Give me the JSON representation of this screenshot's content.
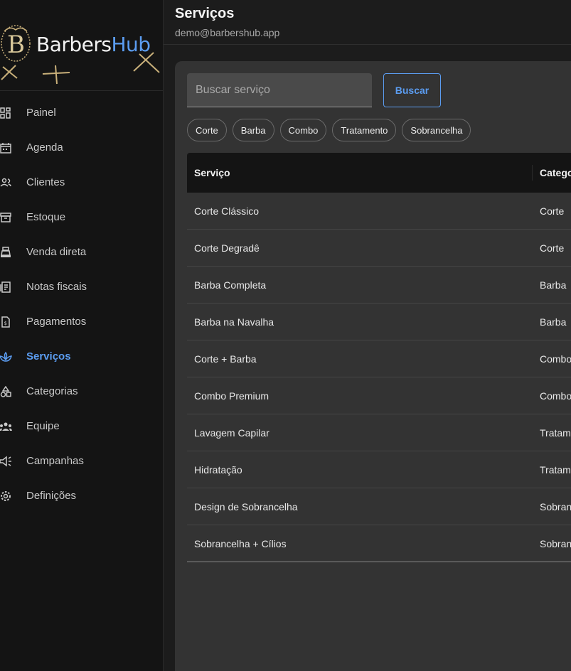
{
  "app": {
    "brand_part1": "Barbers",
    "brand_part2": "Hub",
    "brand_color": "#5b9cf0"
  },
  "sidebar": {
    "items": [
      {
        "label": "Painel",
        "icon": "dashboard-icon"
      },
      {
        "label": "Agenda",
        "icon": "calendar-icon"
      },
      {
        "label": "Clientes",
        "icon": "clients-icon"
      },
      {
        "label": "Estoque",
        "icon": "inventory-icon"
      },
      {
        "label": "Venda direta",
        "icon": "cash-register-icon"
      },
      {
        "label": "Notas fiscais",
        "icon": "receipt-icon"
      },
      {
        "label": "Pagamentos",
        "icon": "payment-doc-icon"
      },
      {
        "label": "Serviços",
        "icon": "spa-icon",
        "active": true
      },
      {
        "label": "Categorias",
        "icon": "category-icon"
      },
      {
        "label": "Equipe",
        "icon": "team-icon"
      },
      {
        "label": "Campanhas",
        "icon": "campaign-icon"
      },
      {
        "label": "Definições",
        "icon": "settings-icon"
      }
    ]
  },
  "header": {
    "title": "Serviços",
    "user_email": "demo@barbershub.app"
  },
  "search": {
    "placeholder": "Buscar serviço",
    "button_label": "Buscar"
  },
  "filters": [
    "Corte",
    "Barba",
    "Combo",
    "Tratamento",
    "Sobrancelha"
  ],
  "table": {
    "columns": [
      "Serviço",
      "Catego"
    ],
    "rows": [
      {
        "service": "Corte Clássico",
        "category": "Corte"
      },
      {
        "service": "Corte Degradê",
        "category": "Corte"
      },
      {
        "service": "Barba Completa",
        "category": "Barba"
      },
      {
        "service": "Barba na Navalha",
        "category": "Barba"
      },
      {
        "service": "Corte + Barba",
        "category": "Combo"
      },
      {
        "service": "Combo Premium",
        "category": "Combo"
      },
      {
        "service": "Lavagem Capilar",
        "category": "Tratam"
      },
      {
        "service": "Hidratação",
        "category": "Tratam"
      },
      {
        "service": "Design de Sobrancelha",
        "category": "Sobran"
      },
      {
        "service": "Sobrancelha + Cílios",
        "category": "Sobran"
      }
    ]
  }
}
